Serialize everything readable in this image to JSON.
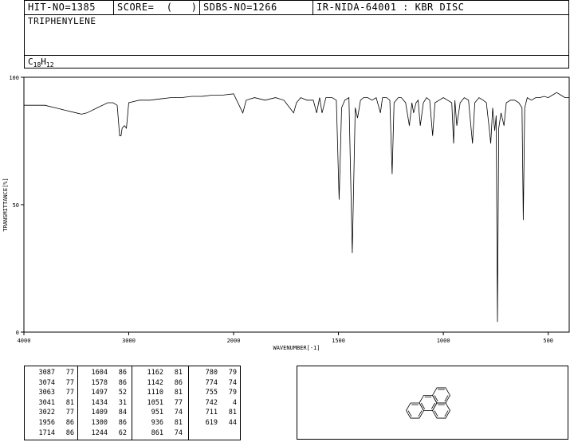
{
  "header": {
    "hit_no": "HIT-NO=1385",
    "score": "SCORE=  (   )",
    "sdbs_no": "SDBS-NO=1266",
    "source": "IR-NIDA-64001 : KBR DISC",
    "compound_name": "TRIPHENYLENE",
    "formula_c": "C",
    "formula_c_sub": "18",
    "formula_h": "H",
    "formula_h_sub": "12"
  },
  "chart_data": {
    "type": "line",
    "xlabel": "WAVENUMBER[-1]",
    "ylabel": "TRANSMITTANCE[%]",
    "xlim": [
      4000,
      400
    ],
    "ylim": [
      0,
      100
    ],
    "x_ticks": [
      "4000",
      "3000",
      "2000",
      "1500",
      "1000",
      "500"
    ],
    "y_ticks": [
      "100",
      "50",
      "0"
    ],
    "series": [
      {
        "x": [
          4000,
          3900,
          3800,
          3700,
          3600,
          3500,
          3450,
          3400,
          3300,
          3200,
          3150,
          3110,
          3087,
          3074,
          3063,
          3041,
          3022,
          3000,
          2900,
          2800,
          2700,
          2600,
          2500,
          2400,
          2300,
          2200,
          2100,
          2000,
          1956,
          1940,
          1900,
          1850,
          1800,
          1760,
          1714,
          1700,
          1680,
          1650,
          1620,
          1604,
          1590,
          1578,
          1560,
          1530,
          1510,
          1497,
          1485,
          1470,
          1450,
          1434,
          1420,
          1409,
          1395,
          1380,
          1360,
          1340,
          1320,
          1300,
          1290,
          1270,
          1255,
          1244,
          1235,
          1215,
          1200,
          1180,
          1162,
          1150,
          1142,
          1130,
          1120,
          1110,
          1095,
          1080,
          1065,
          1051,
          1040,
          1020,
          1000,
          980,
          960,
          951,
          945,
          936,
          920,
          900,
          880,
          861,
          850,
          830,
          810,
          795,
          780,
          774,
          765,
          755,
          748,
          742,
          736,
          725,
          711,
          700,
          680,
          660,
          640,
          625,
          619,
          612,
          600,
          580,
          560,
          540,
          520,
          500,
          480,
          460,
          440,
          420,
          400
        ],
        "y": [
          89,
          89,
          89,
          88,
          87,
          86,
          85.5,
          86,
          88,
          90,
          90,
          89,
          77,
          77,
          80,
          81,
          80,
          90,
          91,
          91,
          91.5,
          92,
          92,
          92.5,
          92.5,
          93,
          93,
          93.5,
          86,
          91,
          92,
          91,
          92,
          91,
          86,
          90,
          92,
          91,
          91,
          86,
          92,
          86,
          92,
          92,
          91,
          52,
          88,
          91,
          92,
          31,
          88,
          84,
          91,
          92,
          92,
          91,
          92,
          86,
          92,
          92,
          91,
          62,
          90,
          92,
          92,
          90,
          81,
          90,
          86,
          90,
          91,
          81,
          90,
          92,
          91,
          77,
          90,
          91,
          92,
          91,
          90,
          74,
          91,
          81,
          90,
          92,
          91,
          74,
          90,
          92,
          91,
          90,
          79,
          74,
          88,
          79,
          85,
          4,
          80,
          86,
          81,
          90,
          91,
          91,
          90,
          88,
          44,
          88,
          92,
          91,
          92,
          92,
          92.5,
          92,
          93,
          94,
          93,
          92,
          92
        ]
      }
    ]
  },
  "peak_table": [
    [
      [
        "3087",
        "77"
      ],
      [
        "3074",
        "77"
      ],
      [
        "3063",
        "77"
      ],
      [
        "3041",
        "81"
      ],
      [
        "3022",
        "77"
      ],
      [
        "1956",
        "86"
      ],
      [
        "1714",
        "86"
      ]
    ],
    [
      [
        "1604",
        "86"
      ],
      [
        "1578",
        "86"
      ],
      [
        "1497",
        "52"
      ],
      [
        "1434",
        "31"
      ],
      [
        "1409",
        "84"
      ],
      [
        "1300",
        "86"
      ],
      [
        "1244",
        "62"
      ]
    ],
    [
      [
        "1162",
        "81"
      ],
      [
        "1142",
        "86"
      ],
      [
        "1110",
        "81"
      ],
      [
        "1051",
        "77"
      ],
      [
        "951",
        "74"
      ],
      [
        "936",
        "81"
      ],
      [
        "861",
        "74"
      ]
    ],
    [
      [
        "780",
        "79"
      ],
      [
        "774",
        "74"
      ],
      [
        "755",
        "79"
      ],
      [
        "742",
        "4"
      ],
      [
        "711",
        "81"
      ],
      [
        "619",
        "44"
      ]
    ]
  ]
}
